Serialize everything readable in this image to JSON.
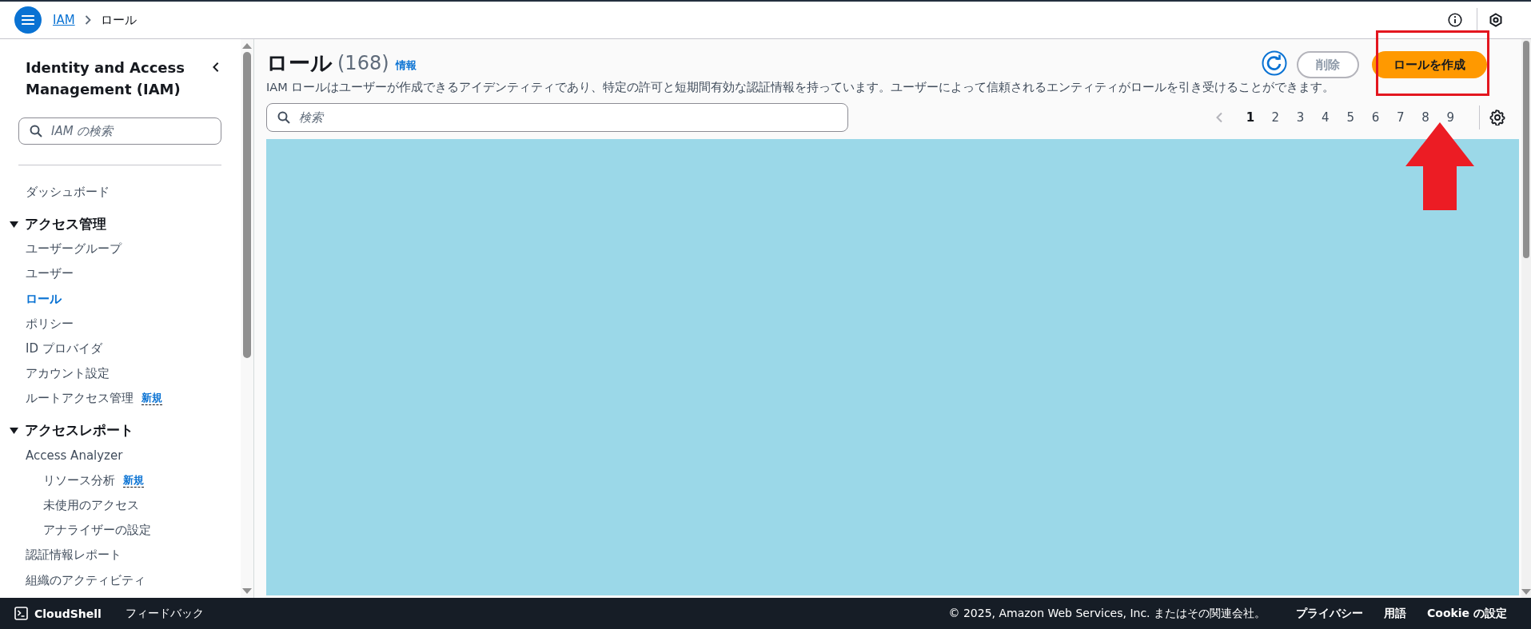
{
  "top_bar": {
    "breadcrumbs": [
      {
        "label": "IAM",
        "link": true
      },
      {
        "label": "ロール",
        "link": false
      }
    ]
  },
  "sidebar": {
    "title": "Identity and Access Management (IAM)",
    "search": {
      "placeholder": "IAM の検索"
    },
    "items": [
      {
        "kind": "link",
        "label": "ダッシュボード",
        "selected": false
      },
      {
        "kind": "section",
        "label": "アクセス管理",
        "expanded": true,
        "children": [
          {
            "kind": "link",
            "label": "ユーザーグループ",
            "selected": false
          },
          {
            "kind": "link",
            "label": "ユーザー",
            "selected": false
          },
          {
            "kind": "link",
            "label": "ロール",
            "selected": true
          },
          {
            "kind": "link",
            "label": "ポリシー",
            "selected": false
          },
          {
            "kind": "link",
            "label": "ID プロバイダ",
            "selected": false
          },
          {
            "kind": "link",
            "label": "アカウント設定",
            "selected": false
          },
          {
            "kind": "link",
            "label": "ルートアクセス管理",
            "badge": "新規",
            "selected": false
          }
        ]
      },
      {
        "kind": "section",
        "label": "アクセスレポート",
        "expanded": true,
        "children": [
          {
            "kind": "link",
            "label": "Access Analyzer",
            "selected": false,
            "children": [
              {
                "kind": "link",
                "label": "リソース分析",
                "badge": "新規",
                "selected": false
              },
              {
                "kind": "link",
                "label": "未使用のアクセス",
                "selected": false
              },
              {
                "kind": "link",
                "label": "アナライザーの設定",
                "selected": false
              }
            ]
          },
          {
            "kind": "link",
            "label": "認証情報レポート",
            "selected": false
          },
          {
            "kind": "link",
            "label": "組織のアクティビティ",
            "selected": false
          }
        ]
      }
    ]
  },
  "main": {
    "title": "ロール",
    "count": "(168)",
    "info": "情報",
    "description": "IAM ロールはユーザーが作成できるアイデンティティであり、特定の許可と短期間有効な認証情報を持っています。ユーザーによって信頼されるエンティティがロールを引き受けることができます。",
    "buttons": [
      {
        "kind": "secondary",
        "label": "削除",
        "disabled": true
      },
      {
        "kind": "primary",
        "label": "ロールを作成",
        "disabled": false
      }
    ],
    "search": {
      "placeholder": "検索"
    },
    "pagination": [
      {
        "label": "1",
        "selected": true
      },
      {
        "label": "2",
        "selected": false
      },
      {
        "label": "3",
        "selected": false
      },
      {
        "label": "4",
        "selected": false
      },
      {
        "label": "5",
        "selected": false
      },
      {
        "label": "6",
        "selected": false
      },
      {
        "label": "7",
        "selected": false
      },
      {
        "label": "8",
        "selected": false
      },
      {
        "label": "9",
        "selected": false
      }
    ]
  },
  "footer": {
    "left": [
      "CloudShell",
      "フィードバック"
    ],
    "copyright": "© 2025, Amazon Web Services, Inc. またはその関連会社。",
    "links": [
      "プライバシー",
      "用語",
      "Cookie の設定"
    ]
  },
  "callout": {
    "box": true,
    "arrow": true
  }
}
